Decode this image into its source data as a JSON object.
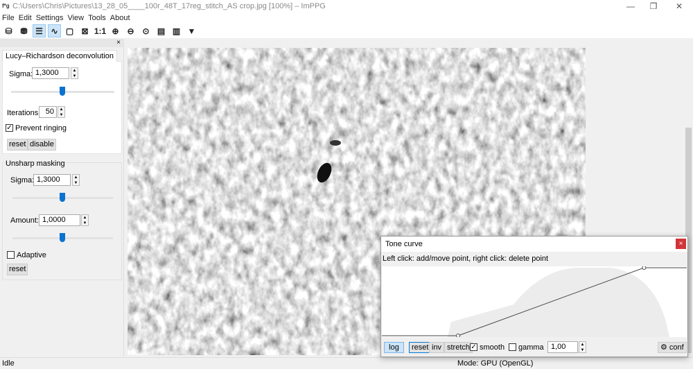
{
  "window": {
    "title": "C:\\Users\\Chris\\Pictures\\13_28_05____100r_48T_17reg_stitch_AS crop.jpg [100%] – ImPPG",
    "app_icon": "f*g"
  },
  "menu": [
    "File",
    "Edit",
    "Settings",
    "View",
    "Tools",
    "About"
  ],
  "toolbar": {
    "items": [
      "open-icon",
      "save-icon",
      "panel-toggle-icon",
      "tone-curve-icon",
      "fit-window-icon",
      "zoom-fit-icon",
      "1:1",
      "zoom-in-icon",
      "zoom-out-icon",
      "zoom-custom-icon",
      "batch-icon",
      "align-icon",
      "combine-icon"
    ],
    "zoom_1to1": "1:1"
  },
  "panel": {
    "close": "×",
    "lr": {
      "title": "Lucy–Richardson deconvolution",
      "sigma_label": "Sigma:",
      "sigma": "1,3000",
      "sigma_slider": 0.5,
      "iterations_label": "Iterations:",
      "iterations": "50",
      "prevent_ringing": "Prevent ringing",
      "prevent_ringing_checked": true,
      "reset": "reset",
      "disable": "disable"
    },
    "usm": {
      "title": "Unsharp masking",
      "sigma_label": "Sigma:",
      "sigma": "1,3000",
      "sigma_slider": 0.5,
      "amount_label": "Amount:",
      "amount": "1,0000",
      "amount_slider": 0.5,
      "adaptive": "Adaptive",
      "adaptive_checked": false,
      "reset": "reset"
    }
  },
  "status": {
    "left": "Idle",
    "mode": "Mode: GPU (OpenGL)"
  },
  "tone_curve": {
    "title": "Tone curve",
    "close": "×",
    "hint": "Left click: add/move point, right click: delete point",
    "points": [
      [
        0.25,
        0.0
      ],
      [
        0.86,
        1.0
      ]
    ],
    "log": "log",
    "reset": "reset",
    "inv": "inv",
    "stretch": "stretch",
    "smooth": "smooth",
    "smooth_checked": true,
    "gamma": "gamma",
    "gamma_checked": false,
    "gamma_value": "1,00",
    "conf": "conf"
  },
  "colors": {
    "accent": "#0a72d1",
    "close_red": "#d13438"
  }
}
